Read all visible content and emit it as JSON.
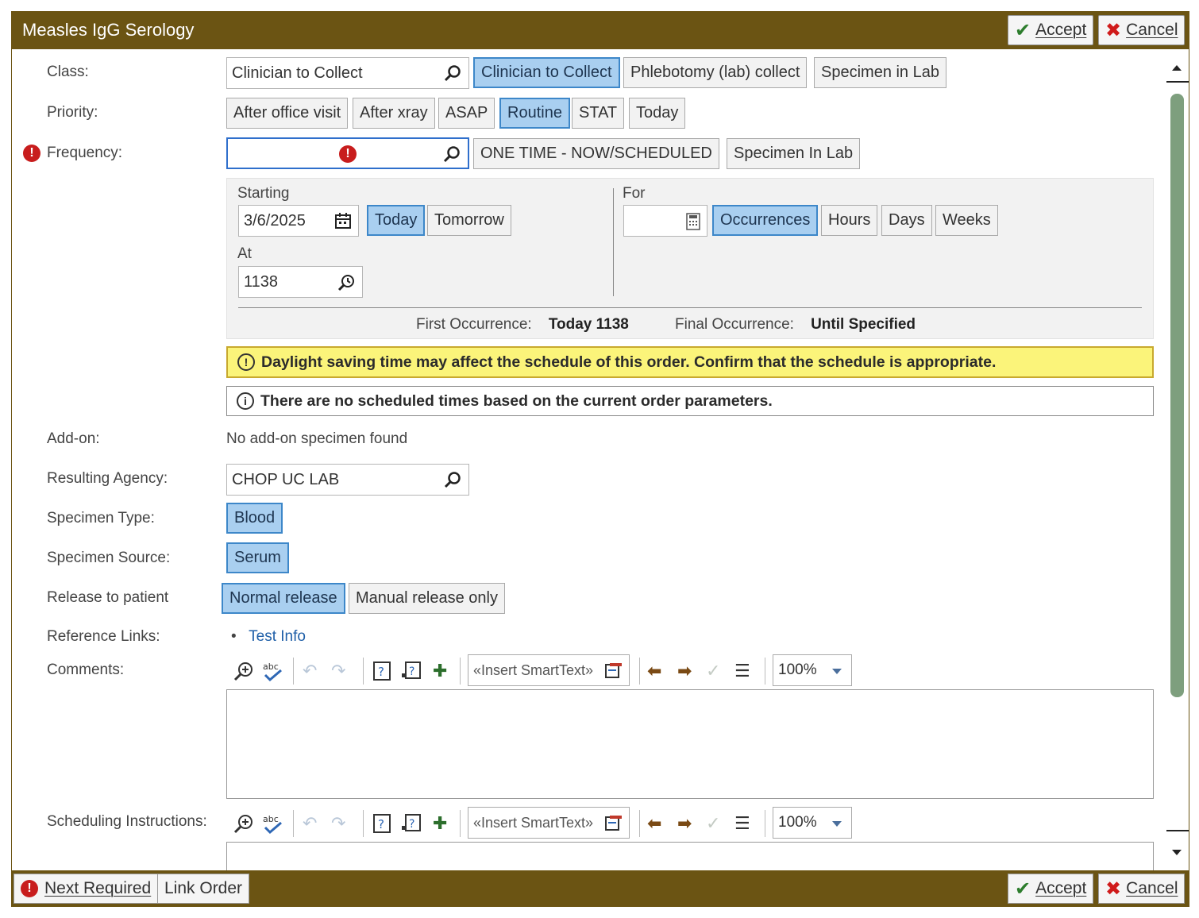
{
  "window": {
    "title": "Measles IgG Serology",
    "accept_label": "Accept",
    "cancel_label": "Cancel"
  },
  "class": {
    "label": "Class:",
    "value": "Clinician to Collect",
    "options": [
      "Clinician to Collect",
      "Phlebotomy (lab) collect",
      "Specimen in Lab"
    ],
    "selected": "Clinician to Collect"
  },
  "priority": {
    "label": "Priority:",
    "options": [
      "After office visit",
      "After xray",
      "ASAP",
      "Routine",
      "STAT",
      "Today"
    ],
    "selected": "Routine"
  },
  "frequency": {
    "label": "Frequency:",
    "value": "",
    "options": [
      "ONE TIME - NOW/SCHEDULED",
      "Specimen In Lab"
    ]
  },
  "schedule": {
    "starting_label": "Starting",
    "starting_value": "3/6/2025",
    "today_label": "Today",
    "tomorrow_label": "Tomorrow",
    "at_label": "At",
    "at_value": "1138",
    "for_label": "For",
    "for_value": "",
    "for_options": [
      "Occurrences",
      "Hours",
      "Days",
      "Weeks"
    ],
    "for_selected": "Occurrences",
    "first_occ_label": "First Occurrence:",
    "first_occ_value": "Today 1138",
    "final_occ_label": "Final Occurrence:",
    "final_occ_value": "Until Specified"
  },
  "messages": {
    "warning": "Daylight saving time may affect the schedule of this order. Confirm that the schedule is appropriate.",
    "info": "There are no scheduled times based on the current order parameters."
  },
  "addon": {
    "label": "Add-on:",
    "value": "No add-on specimen found"
  },
  "resulting_agency": {
    "label": "Resulting Agency:",
    "value": "CHOP UC LAB"
  },
  "specimen_type": {
    "label": "Specimen Type:",
    "value": "Blood"
  },
  "specimen_source": {
    "label": "Specimen Source:",
    "value": "Serum"
  },
  "release": {
    "label": "Release to patient",
    "options": [
      "Normal release",
      "Manual release only"
    ],
    "selected": "Normal release"
  },
  "reference_links": {
    "label": "Reference Links:",
    "links": [
      "Test Info"
    ]
  },
  "comments": {
    "label": "Comments:",
    "smarttext_placeholder": "«Insert SmartText»",
    "zoom": "100%"
  },
  "scheduling_instructions": {
    "label": "Scheduling Instructions:",
    "smarttext_placeholder": "«Insert SmartText»",
    "zoom": "100%"
  },
  "footer": {
    "next_required_label": "Next Required",
    "link_order_label": "Link Order",
    "accept_label": "Accept",
    "cancel_label": "Cancel"
  },
  "colors": {
    "title_bar": "#6b5413",
    "selected_button": "#a9cff0",
    "warning_bg": "#fbf47a",
    "error_red": "#c81d1d",
    "scroll_thumb": "#7e9f7e"
  }
}
